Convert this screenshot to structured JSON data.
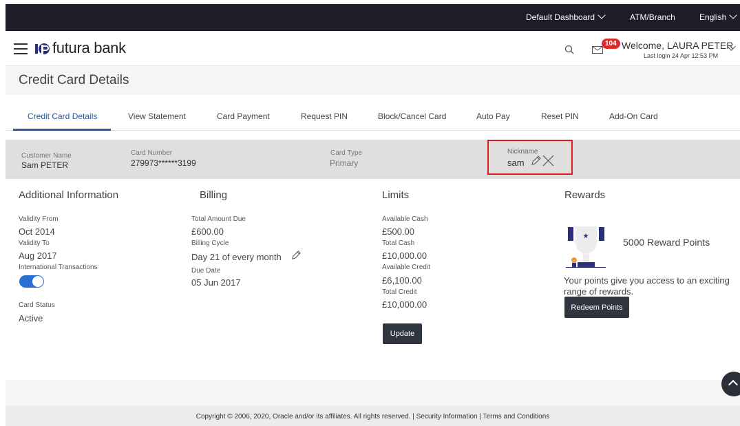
{
  "topbar": {
    "dashboard": "Default Dashboard",
    "atm_branch": "ATM/Branch",
    "language": "English"
  },
  "header": {
    "brand": "futura bank",
    "notification_count": "104",
    "welcome": "Welcome, LAURA PETER",
    "last_login": "Last login 24 Apr 12:53 PM"
  },
  "page": {
    "title": "Credit Card Details"
  },
  "tabs": [
    {
      "label": "Credit Card Details"
    },
    {
      "label": "View Statement"
    },
    {
      "label": "Card Payment"
    },
    {
      "label": "Request PIN"
    },
    {
      "label": "Block/Cancel Card"
    },
    {
      "label": "Auto Pay"
    },
    {
      "label": "Reset PIN"
    },
    {
      "label": "Add-On Card"
    }
  ],
  "summary": {
    "customer_name_label": "Customer Name",
    "customer_name": "Sam PETER",
    "card_number_label": "Card Number",
    "card_number": "279973******3199",
    "card_type_label": "Card Type",
    "card_type": "Primary",
    "nickname_label": "Nickname",
    "nickname": "sam"
  },
  "additional": {
    "heading": "Additional Information",
    "validity_from_label": "Validity From",
    "validity_from": "Oct 2014",
    "validity_to_label": "Validity To",
    "validity_to": "Aug 2017",
    "intl_label": "International Transactions",
    "intl_enabled": true,
    "status_label": "Card Status",
    "status": "Active"
  },
  "billing": {
    "heading": "Billing",
    "total_due_label": "Total Amount Due",
    "total_due": "£600.00",
    "cycle_label": "Billing Cycle",
    "cycle": "Day 21 of every month",
    "due_date_label": "Due Date",
    "due_date": "05 Jun 2017"
  },
  "limits": {
    "heading": "Limits",
    "avail_cash_label": "Available Cash",
    "avail_cash": "£500.00",
    "total_cash_label": "Total Cash",
    "total_cash": "£10,000.00",
    "avail_credit_label": "Available Credit",
    "avail_credit": "£6,100.00",
    "total_credit_label": "Total Credit",
    "total_credit": "£10,000.00",
    "update_button": "Update"
  },
  "rewards": {
    "heading": "Rewards",
    "points": "5000 Reward Points",
    "description": "Your points give you access to an exciting range of rewards.",
    "redeem_button": "Redeem Points"
  },
  "footer": {
    "copyright": "Copyright © 2006, 2020, Oracle and/or its affiliates. All rights reserved. | Security Information | Terms and Conditions"
  },
  "colors": {
    "topbar": "#1d1c29",
    "accent": "#2b5aa6",
    "highlight_box": "#e02020",
    "badge": "#d62e2e"
  }
}
